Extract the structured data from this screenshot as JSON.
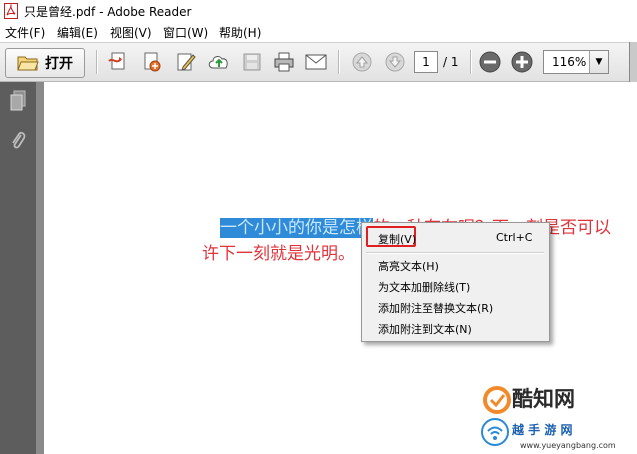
{
  "window": {
    "title": "只是曾经.pdf - Adobe Reader"
  },
  "menu": {
    "items": [
      "文件(F)",
      "编辑(E)",
      "视图(V)",
      "窗口(W)",
      "帮助(H)"
    ]
  },
  "toolbar": {
    "open_label": "打开",
    "page_current": "1",
    "page_total": "/ 1",
    "zoom": "116%"
  },
  "document": {
    "selected_text": "一个小小的你是怎样",
    "line1_rest": "的一种存在呢？下一刻是否可以",
    "line2": "许下一刻就是光明。"
  },
  "context_menu": {
    "copy": {
      "label": "复制(V)",
      "shortcut": "Ctrl+C"
    },
    "items": [
      "高亮文本(H)",
      "为文本加删除线(T)",
      "添加附注至替换文本(R)",
      "添加附注到文本(N)"
    ]
  },
  "watermark": {
    "brand": "酷知网",
    "site_name": "越 手 游 网",
    "site_url": "www.yueyangbang.com"
  },
  "colors": {
    "selection": "#2f8bd8",
    "doc_text": "#e0333a",
    "highlight_frame": "#e02020",
    "side_panel": "#5d5d5d"
  }
}
